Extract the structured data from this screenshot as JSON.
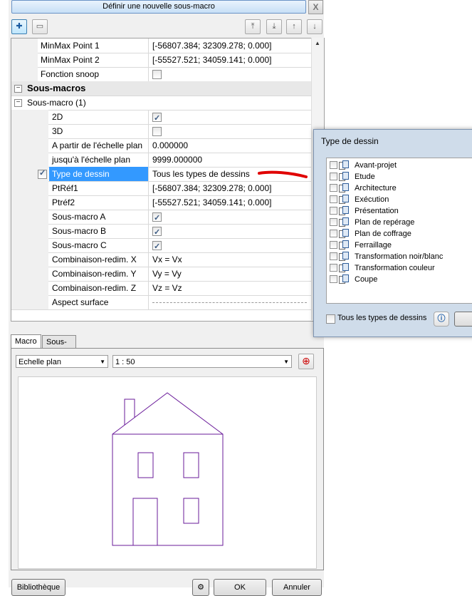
{
  "header": {
    "define_button": "Définir une nouvelle sous-macro",
    "close_label": "X"
  },
  "properties": {
    "rows": [
      {
        "name": "MinMax Point 1",
        "value": "[-56807.384; 32309.278; 0.000]"
      },
      {
        "name": "MinMax Point 2",
        "value": "[-55527.521; 34059.141; 0.000]"
      },
      {
        "name": "Fonction snoop",
        "checkbox": false
      },
      {
        "section": "Sous-macros"
      },
      {
        "group": "Sous-macro (1)"
      },
      {
        "name": "2D",
        "checkbox": true
      },
      {
        "name": "3D",
        "checkbox": false
      },
      {
        "name": "A partir de l'échelle plan",
        "value": "0.000000"
      },
      {
        "name": "jusqu'à l'échelle plan",
        "value": "9999.000000"
      },
      {
        "name": "Type de dessin",
        "value": "Tous les types de dessins",
        "selected": true,
        "row_check": true
      },
      {
        "name": "PtRéf1",
        "value": "[-56807.384; 32309.278; 0.000]"
      },
      {
        "name": "Ptréf2",
        "value": "[-55527.521; 34059.141; 0.000]"
      },
      {
        "name": "Sous-macro A",
        "checkbox": true
      },
      {
        "name": "Sous-macro B",
        "checkbox": true
      },
      {
        "name": "Sous-macro C",
        "checkbox": true
      },
      {
        "name": "Combinaison-redim. X",
        "value": "Vx = Vx"
      },
      {
        "name": "Combinaison-redim. Y",
        "value": "Vy = Vy"
      },
      {
        "name": "Combinaison-redim. Z",
        "value": "Vz = Vz"
      },
      {
        "name": "Aspect surface",
        "value": ""
      }
    ]
  },
  "tabs": {
    "macro": "Macro",
    "submacros": "Sous-macros"
  },
  "scale": {
    "type_value": "Echelle plan",
    "ratio_value": "1 : 50"
  },
  "footer": {
    "library": "Bibliothèque",
    "ok": "OK",
    "cancel": "Annuler"
  },
  "dialog": {
    "title": "Type de dessin",
    "items": [
      "Avant-projet",
      "Etude",
      "Architecture",
      "Exécution",
      "Présentation",
      "Plan de repérage",
      "Plan de coffrage",
      "Ferraillage",
      "Transformation noir/blanc",
      "Transformation couleur",
      "Coupe"
    ],
    "all_label": "Tous les types de dessins",
    "all_checked": false
  },
  "colors": {
    "house_stroke": "#6a1b9a",
    "selection": "#3399ff",
    "annotation": "#e00000"
  }
}
